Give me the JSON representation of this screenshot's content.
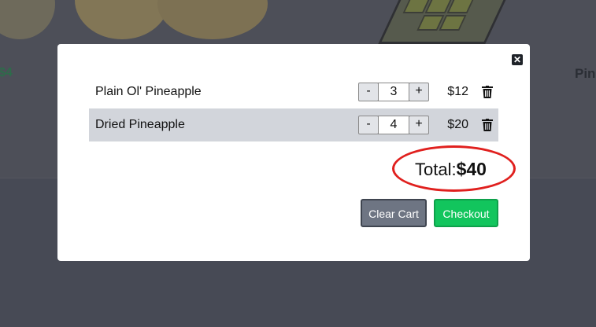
{
  "background": {
    "visible_price": "$4",
    "visible_name": "Pin"
  },
  "modal": {
    "close_icon": "close-icon",
    "items": [
      {
        "name": "Plain Ol' Pineapple",
        "qty_minus": "-",
        "qty": "3",
        "qty_plus": "+",
        "price": "$12"
      },
      {
        "name": "Dried Pineapple",
        "qty_minus": "-",
        "qty": "4",
        "qty_plus": "+",
        "price": "$20"
      }
    ],
    "total_label": "Total:",
    "total_value": "$40",
    "clear_label": "Clear Cart",
    "checkout_label": "Checkout"
  },
  "colors": {
    "checkout": "#12c55d",
    "clear": "#6e7583",
    "highlight": "#e0201e",
    "row_alt": "#d2d5db"
  }
}
